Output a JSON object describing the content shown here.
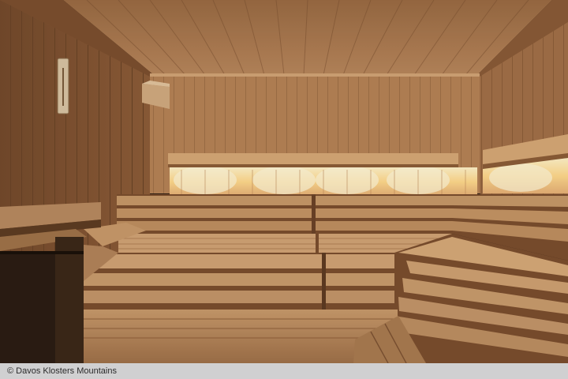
{
  "photo": {
    "caption": "© Davos Klosters Mountains"
  },
  "colors": {
    "ceiling": "#a8764e",
    "wall": "#b98658",
    "bench": "#c49668",
    "glow": "#ffe6a8",
    "shadow": "#3a2415"
  }
}
